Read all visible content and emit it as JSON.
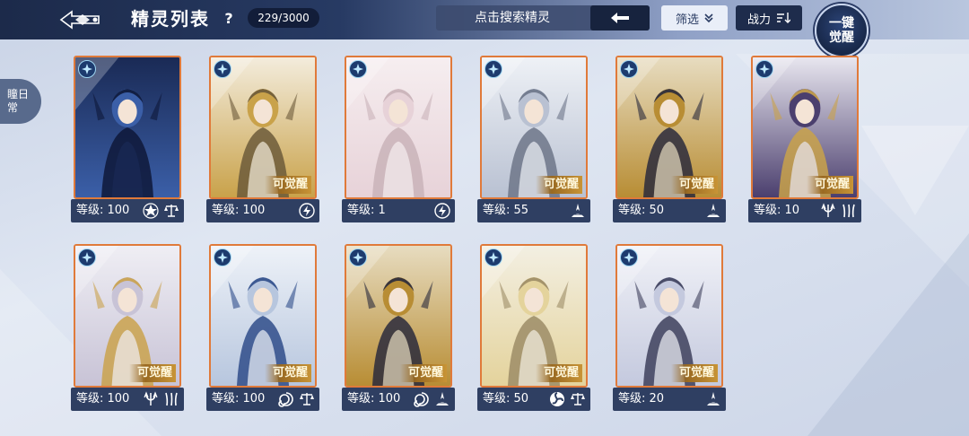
{
  "header": {
    "title": "精灵列表",
    "help": "?",
    "count": "229/3000",
    "search_placeholder": "点击搜索精灵",
    "filter_label": "筛选",
    "power_label": "战力",
    "awaken_all_line1": "一键",
    "awaken_all_line2": "觉醒"
  },
  "side_tab": {
    "line1": "瞳日",
    "line2": "常"
  },
  "colors": {
    "topbar_dark": "#1c2a4a",
    "card_border": "#e07a3a",
    "card_footer": "#2f3f62",
    "awaken_gold": "#c89436"
  },
  "cards": [
    {
      "level": "等级: 100",
      "awaken": "",
      "icons": [
        "star-emblem-icon",
        "scales-icon"
      ],
      "palette": "dark-blue"
    },
    {
      "level": "等级: 100",
      "awaken": "可觉醒",
      "icons": [
        "lightning-icon"
      ],
      "palette": "gold-white"
    },
    {
      "level": "等级: 1",
      "awaken": "",
      "icons": [
        "lightning-icon"
      ],
      "palette": "pink-white"
    },
    {
      "level": "等级: 55",
      "awaken": "可觉醒",
      "icons": [
        "light-spire-icon"
      ],
      "palette": "silver"
    },
    {
      "level": "等级: 50",
      "awaken": "可觉醒",
      "icons": [
        "light-spire-icon"
      ],
      "palette": "gold-armor"
    },
    {
      "level": "等级: 10",
      "awaken": "可觉醒",
      "icons": [
        "trident-icon",
        "claw-icon"
      ],
      "palette": "purple-gold"
    },
    {
      "level": "等级: 100",
      "awaken": "可觉醒",
      "icons": [
        "trident-icon",
        "claw-icon"
      ],
      "palette": "silver-gold"
    },
    {
      "level": "等级: 100",
      "awaken": "可觉醒",
      "icons": [
        "spiral-icon",
        "scales-icon"
      ],
      "palette": "white-blue"
    },
    {
      "level": "等级: 100",
      "awaken": "可觉醒",
      "icons": [
        "spiral-icon",
        "light-spire-icon"
      ],
      "palette": "gold-armor"
    },
    {
      "level": "等级: 50",
      "awaken": "可觉醒",
      "icons": [
        "triskele-icon",
        "scales-icon"
      ],
      "palette": "blonde"
    },
    {
      "level": "等级: 20",
      "awaken": "可觉醒",
      "icons": [
        "light-spire-icon"
      ],
      "palette": "violin"
    }
  ]
}
